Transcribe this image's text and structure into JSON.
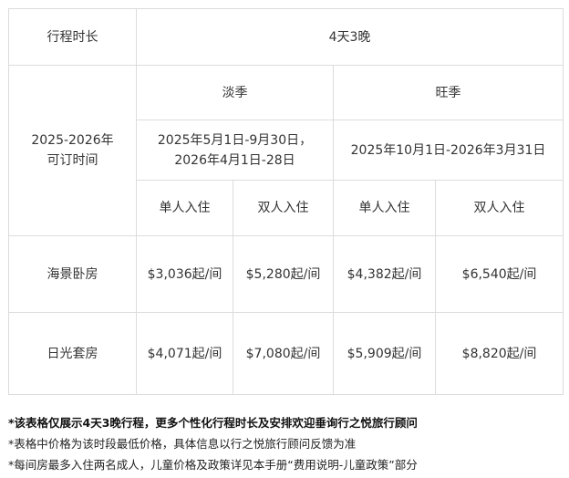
{
  "table": {
    "duration_label": "行程时长",
    "duration_value": "4天3晚",
    "bookable_label": "2025-2026年可订时间",
    "bookable_label_lines": [
      "2025-2026年",
      "可订时间"
    ],
    "seasons": [
      {
        "name": "淡季",
        "period_lines": [
          "2025年5月1日-9月30日，",
          "2026年4月1日-28日"
        ]
      },
      {
        "name": "旺季",
        "period_lines": [
          "2025年10月1日-2026年3月31日"
        ]
      }
    ],
    "occupancy_headers": [
      "单人入住",
      "双人入住",
      "单人入住",
      "双人入住"
    ],
    "rooms": [
      {
        "name": "海景卧房",
        "prices": [
          "$3,036起/间",
          "$5,280起/间",
          "$4,382起/间",
          "$6,540起/间"
        ]
      },
      {
        "name": "日光套房",
        "prices": [
          "$4,071起/间",
          "$7,080起/间",
          "$5,909起/间",
          "$8,820起/间"
        ]
      }
    ]
  },
  "notes": [
    "*该表格仅展示4天3晚行程，更多个性化行程时长及安排欢迎垂询行之悦旅行顾问",
    "*表格中价格为该时段最低价格，具体信息以行之悦旅行顾问反馈为准",
    "*每间房最多入住两名成人，儿童价格及政策详见本手册“费用说明-儿童政策”部分"
  ]
}
